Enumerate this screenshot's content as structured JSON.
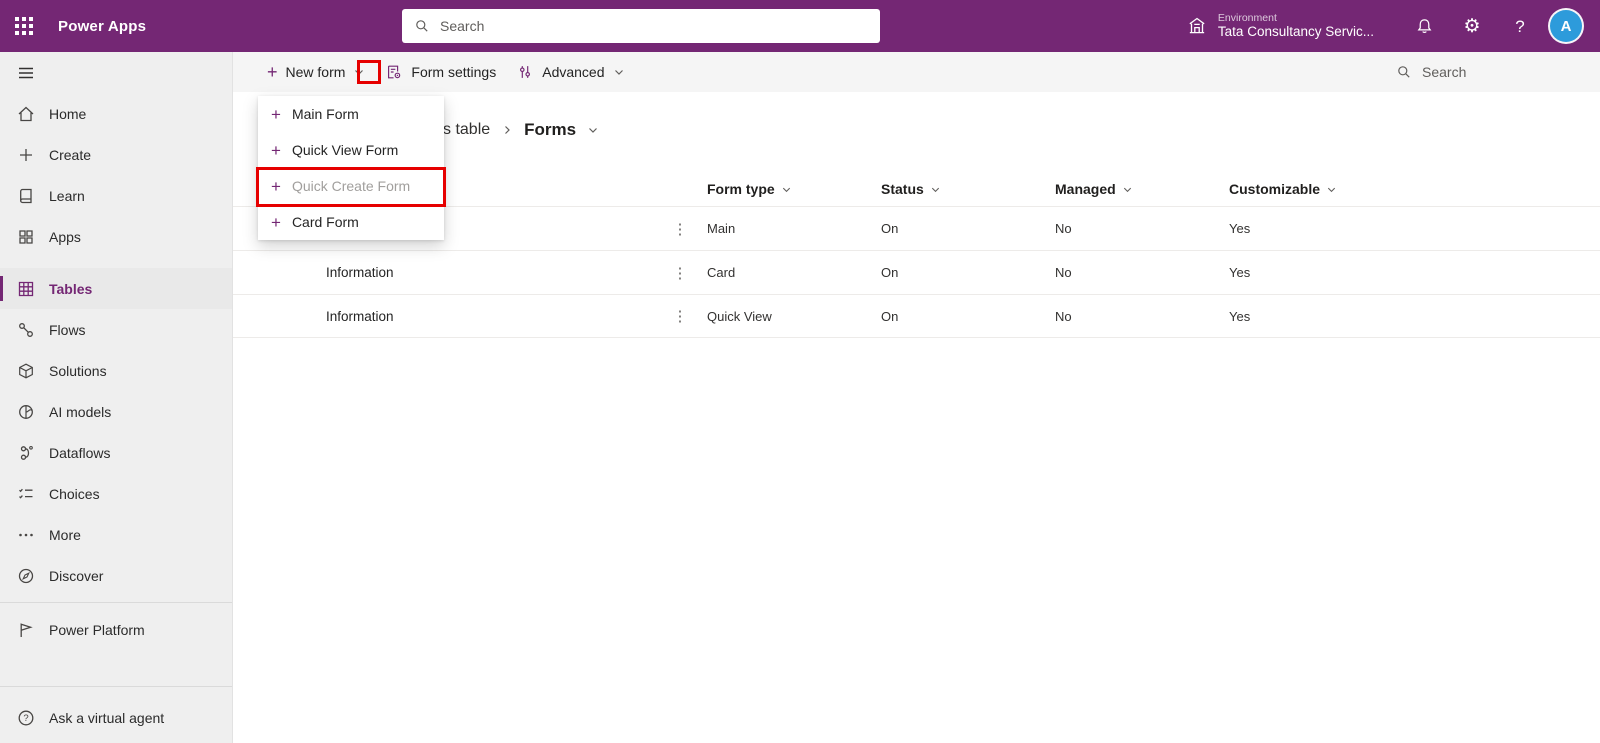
{
  "colors": {
    "brand_purple": "#742774",
    "highlight_red": "#e60000",
    "avatar_blue": "#2d9bdb"
  },
  "icons": {
    "plus": "+",
    "row_menu": "⋮",
    "gear": "⚙",
    "help": "?"
  },
  "top_bar": {
    "app_name": "Power Apps",
    "search_placeholder": "Search",
    "environment_label": "Environment",
    "environment_name": "Tata Consultancy Servic...",
    "avatar_initial": "A"
  },
  "sidebar": {
    "items": [
      {
        "label": "Home"
      },
      {
        "label": "Create"
      },
      {
        "label": "Learn"
      },
      {
        "label": "Apps"
      },
      {
        "label": "Tables",
        "selected": true
      },
      {
        "label": "Flows"
      },
      {
        "label": "Solutions"
      },
      {
        "label": "AI models"
      },
      {
        "label": "Dataflows"
      },
      {
        "label": "Choices"
      },
      {
        "label": "More"
      },
      {
        "label": "Discover"
      }
    ],
    "power_platform_label": "Power Platform",
    "ask_agent_label": "Ask a virtual agent"
  },
  "command_bar": {
    "new_form": "New form",
    "form_settings": "Form settings",
    "advanced": "Advanced",
    "search_placeholder": "Search"
  },
  "new_form_menu": {
    "items": [
      {
        "label": "Main Form"
      },
      {
        "label": "Quick View Form"
      },
      {
        "label": "Quick Create Form",
        "highlighted": true
      },
      {
        "label": "Card Form"
      }
    ]
  },
  "breadcrumb": {
    "visible_fragment": "s table",
    "current_page": "Forms"
  },
  "forms_table": {
    "columns": [
      "Form type",
      "Status",
      "Managed",
      "Customizable"
    ],
    "rows": [
      {
        "name": "",
        "form_type": "Main",
        "status": "On",
        "managed": "No",
        "customizable": "Yes"
      },
      {
        "name": "Information",
        "form_type": "Card",
        "status": "On",
        "managed": "No",
        "customizable": "Yes"
      },
      {
        "name": "Information",
        "form_type": "Quick View",
        "status": "On",
        "managed": "No",
        "customizable": "Yes"
      }
    ]
  }
}
